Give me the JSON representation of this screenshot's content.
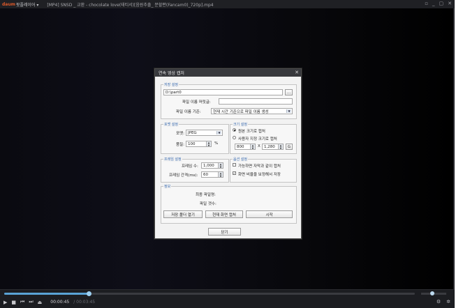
{
  "player": {
    "logo": "daum",
    "app_name": "팟플레이어 ▾",
    "title": "[MP4] SNSD _ 교환 - chocolate love(태티서)[음원추출_ 분할편(Fancam0)_720p].mp4",
    "win_buttons": [
      "▫",
      "_",
      "▢",
      "✕"
    ],
    "time_current": "00:00:45",
    "time_total": "/ 00:03:45",
    "seek_progress": 0.205,
    "volume_level": 0.45,
    "ctrl_icons": [
      "▶",
      "■",
      "⏮",
      "⏭",
      "⏏"
    ],
    "right_icons": [
      "⚙",
      "✲"
    ]
  },
  "dialog": {
    "title": "연속 영상 캡처",
    "close": "✕",
    "save": {
      "label": "저장 설정",
      "path": "D:\\part0",
      "browse": "...",
      "prefix_label": "파일 이름 머릿글:",
      "prefix_value": "",
      "naming_label": "파일 이름 기준:",
      "naming_value": "현재 시간 기준으로 파일 이름 생성"
    },
    "format": {
      "label": "포맷 설정",
      "form_label": "포맷:",
      "form_value": "JPEG",
      "quality_label": "품질:",
      "quality_value": "100",
      "quality_unit": "%"
    },
    "size": {
      "label": "크기 설정",
      "original": "원본 크기로 캡처",
      "custom": "사용자 지정 크기로 캡처",
      "width": "800",
      "x": "X",
      "height": "1,280",
      "g": "G"
    },
    "frame": {
      "label": "프레임 설정",
      "count_label": "프레임 수:",
      "count_value": "1,000",
      "interval_label": "프레임 간격(ms):",
      "interval_value": "60"
    },
    "options": {
      "label": "옵션 설정",
      "opt1": "가능하면 자막과 같이 캡처",
      "opt1_checked": false,
      "opt2": "화면 비율을 보정해서 저장",
      "opt2_checked": true
    },
    "info": {
      "label": "정보",
      "last_file_label": "최종 파일명:",
      "file_count_label": "파일 갯수:"
    },
    "buttons": {
      "open_folder": "저장 폴더 열기",
      "capture_current": "현재 화면 캡처",
      "start": "시작",
      "close": "닫기"
    }
  }
}
